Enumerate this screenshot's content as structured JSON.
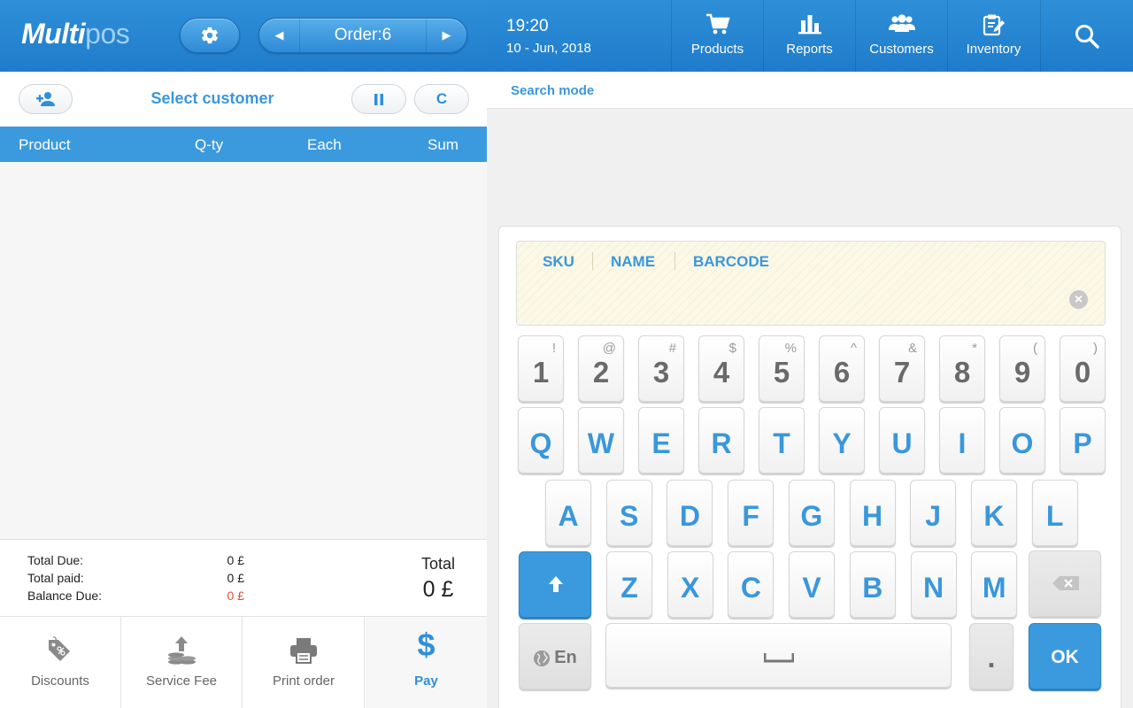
{
  "app": {
    "logo_bold": "Multi",
    "logo_light": "pos"
  },
  "order": {
    "label": "Order:6"
  },
  "customer": {
    "select_label": "Select customer",
    "clear_label": "C"
  },
  "table": {
    "headers": [
      "Product",
      "Q-ty",
      "Each",
      "Sum"
    ]
  },
  "totals": {
    "total_due_label": "Total Due:",
    "total_due": "0 £",
    "total_paid_label": "Total paid:",
    "total_paid": "0 £",
    "balance_due_label": "Balance Due:",
    "balance_due": "0 £",
    "total_label": "Total",
    "total_value": "0 £"
  },
  "actions": [
    {
      "label": "Discounts",
      "icon": "discount-tag-icon"
    },
    {
      "label": "Service Fee",
      "icon": "service-fee-icon"
    },
    {
      "label": "Print order",
      "icon": "printer-icon"
    },
    {
      "label": "Pay",
      "icon": "dollar-icon"
    }
  ],
  "header": {
    "time": "19:20",
    "date": "10 - Jun, 2018",
    "nav": [
      {
        "label": "Products",
        "icon": "cart-icon"
      },
      {
        "label": "Reports",
        "icon": "bar-chart-icon"
      },
      {
        "label": "Customers",
        "icon": "users-icon"
      },
      {
        "label": "Inventory",
        "icon": "clipboard-edit-icon"
      }
    ]
  },
  "search": {
    "mode_label": "Search mode",
    "tabs": [
      "SKU",
      "NAME",
      "BARCODE"
    ]
  },
  "keyboard": {
    "number_row": [
      {
        "main": "1",
        "sym": "!"
      },
      {
        "main": "2",
        "sym": "@"
      },
      {
        "main": "3",
        "sym": "#"
      },
      {
        "main": "4",
        "sym": "$"
      },
      {
        "main": "5",
        "sym": "%"
      },
      {
        "main": "6",
        "sym": "^"
      },
      {
        "main": "7",
        "sym": "&"
      },
      {
        "main": "8",
        "sym": "*"
      },
      {
        "main": "9",
        "sym": "("
      },
      {
        "main": "0",
        "sym": ")"
      }
    ],
    "row1": [
      "Q",
      "W",
      "E",
      "R",
      "T",
      "Y",
      "U",
      "I",
      "O",
      "P"
    ],
    "row2": [
      "A",
      "S",
      "D",
      "F",
      "G",
      "H",
      "J",
      "K",
      "L"
    ],
    "row3": [
      "Z",
      "X",
      "C",
      "V",
      "B",
      "N",
      "M"
    ],
    "lang_label": "En",
    "dot_label": ".",
    "ok_label": "OK"
  },
  "colors": {
    "accent": "#3b9ade",
    "header": "#2484cf",
    "balance_red": "#e64b3b"
  }
}
